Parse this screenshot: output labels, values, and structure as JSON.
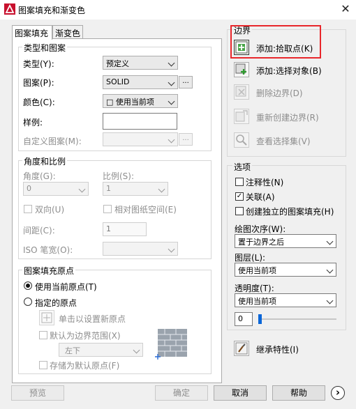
{
  "window": {
    "title": "图案填充和渐变色",
    "close": "✕"
  },
  "tabs": [
    "图案填充",
    "渐变色"
  ],
  "type_pattern": {
    "group_title": "类型和图案",
    "type_label": "类型(Y):",
    "type_value": "预定义",
    "pattern_label": "图案(P):",
    "pattern_value": "SOLID",
    "color_label": "颜色(C):",
    "color_value": "□ 使用当前项",
    "swatch_label": "样例:",
    "custom_label": "自定义图案(M):",
    "ellipsis": "..."
  },
  "angle_scale": {
    "group_title": "角度和比例",
    "angle_label": "角度(G):",
    "angle_value": "0",
    "scale_label": "比例(S):",
    "scale_value": "1",
    "double_label": "双向(U)",
    "relative_label": "相对图纸空间(E)",
    "spacing_label": "间距(C):",
    "spacing_value": "1",
    "iso_label": "ISO 笔宽(O):"
  },
  "origin": {
    "group_title": "图案填充原点",
    "use_current": "使用当前原点(T)",
    "specified": "指定的原点",
    "click_set": "单击以设置新原点",
    "default_extent": "默认为边界范围(X)",
    "extent_value": "左下",
    "store_default": "存储为默认原点(F)"
  },
  "boundaries": {
    "group_title": "边界",
    "add_pick": "添加:拾取点(K)",
    "add_select": "添加:选择对象(B)",
    "remove": "删除边界(D)",
    "recreate": "重新创建边界(R)",
    "view": "查看选择集(V)",
    "highlight_color": "#e8262b"
  },
  "options": {
    "group_title": "选项",
    "annotative": "注释性(N)",
    "associative": "关联(A)",
    "separate": "创建独立的图案填充(H)",
    "draw_order_label": "绘图次序(W):",
    "draw_order_value": "置于边界之后",
    "layer_label": "图层(L):",
    "layer_value": "使用当前项",
    "transparency_label": "透明度(T):",
    "transparency_value": "使用当前项",
    "transparency_number": "0",
    "transparency_fraction": 0
  },
  "inherit": "继承特性(I)",
  "footer": {
    "preview": "预览",
    "ok": "确定",
    "cancel": "取消",
    "help": "帮助",
    "more": "›"
  }
}
